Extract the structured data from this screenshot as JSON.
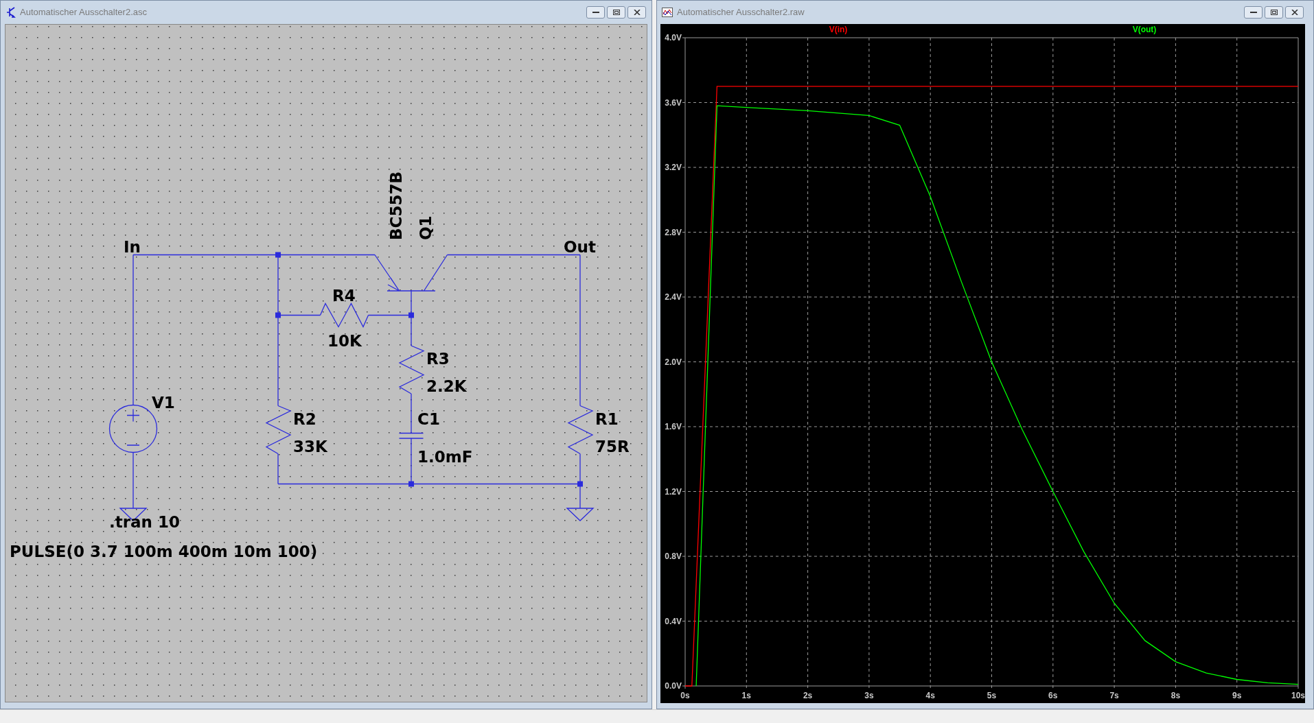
{
  "schematic_window": {
    "title": "Automatischer Ausschalter2.asc",
    "net_labels": [
      "In",
      "Out"
    ],
    "components": [
      {
        "kind": "source",
        "name": "V1",
        "value": "PULSE(0 3.7 100m 400m 10m 100)"
      },
      {
        "kind": "resistor_v",
        "name": "R2",
        "value": "33K"
      },
      {
        "kind": "resistor_h",
        "name": "R4",
        "value": "10K"
      },
      {
        "kind": "transistor",
        "name": "Q1",
        "value": "BC557B"
      },
      {
        "kind": "resistor_v",
        "name": "R3",
        "value": "2.2K"
      },
      {
        "kind": "capacitor",
        "name": "C1",
        "value": "1.0mF"
      },
      {
        "kind": "resistor_v",
        "name": "R1",
        "value": "75R"
      }
    ],
    "directives": [
      ".tran 10"
    ]
  },
  "plot_window": {
    "title": "Automatischer Ausschalter2.raw",
    "chart_data": {
      "type": "line",
      "x": [
        0,
        0.11,
        0.18,
        0.52,
        1,
        2,
        3,
        3.5,
        4,
        4.5,
        5,
        5.5,
        6,
        6.5,
        7,
        7.5,
        8,
        8.5,
        9,
        9.5,
        10
      ],
      "series": [
        {
          "name": "V(in)",
          "color": "#ff0000",
          "values": [
            0,
            0,
            0.63,
            3.7,
            3.7,
            3.7,
            3.7,
            3.7,
            3.7,
            3.7,
            3.7,
            3.7,
            3.7,
            3.7,
            3.7,
            3.7,
            3.7,
            3.7,
            3.7,
            3.7,
            3.7
          ]
        },
        {
          "name": "V(out)",
          "color": "#00ff00",
          "values": [
            null,
            null,
            0,
            3.58,
            3.57,
            3.55,
            3.52,
            3.46,
            3.02,
            2.5,
            2.0,
            1.58,
            1.2,
            0.83,
            0.51,
            0.28,
            0.15,
            0.08,
            0.04,
            0.02,
            0.01
          ]
        }
      ],
      "grid": true,
      "xlim": [
        0,
        10
      ],
      "ylim": [
        0,
        4
      ],
      "xticks": [
        {
          "value": 0,
          "label": "0s"
        },
        {
          "value": 1,
          "label": "1s"
        },
        {
          "value": 2,
          "label": "2s"
        },
        {
          "value": 3,
          "label": "3s"
        },
        {
          "value": 4,
          "label": "4s"
        },
        {
          "value": 5,
          "label": "5s"
        },
        {
          "value": 6,
          "label": "6s"
        },
        {
          "value": 7,
          "label": "7s"
        },
        {
          "value": 8,
          "label": "8s"
        },
        {
          "value": 9,
          "label": "9s"
        },
        {
          "value": 10,
          "label": "10s"
        }
      ],
      "yticks": [
        {
          "value": 0,
          "label": "0.0V"
        },
        {
          "value": 0.4,
          "label": "0.4V"
        },
        {
          "value": 0.8,
          "label": "0.8V"
        },
        {
          "value": 1.2,
          "label": "1.2V"
        },
        {
          "value": 1.6,
          "label": "1.6V"
        },
        {
          "value": 2,
          "label": "2.0V"
        },
        {
          "value": 2.4,
          "label": "2.4V"
        },
        {
          "value": 2.8,
          "label": "2.8V"
        },
        {
          "value": 3.2,
          "label": "3.2V"
        },
        {
          "value": 3.6,
          "label": "3.6V"
        },
        {
          "value": 4,
          "label": "4.0V"
        }
      ]
    }
  }
}
